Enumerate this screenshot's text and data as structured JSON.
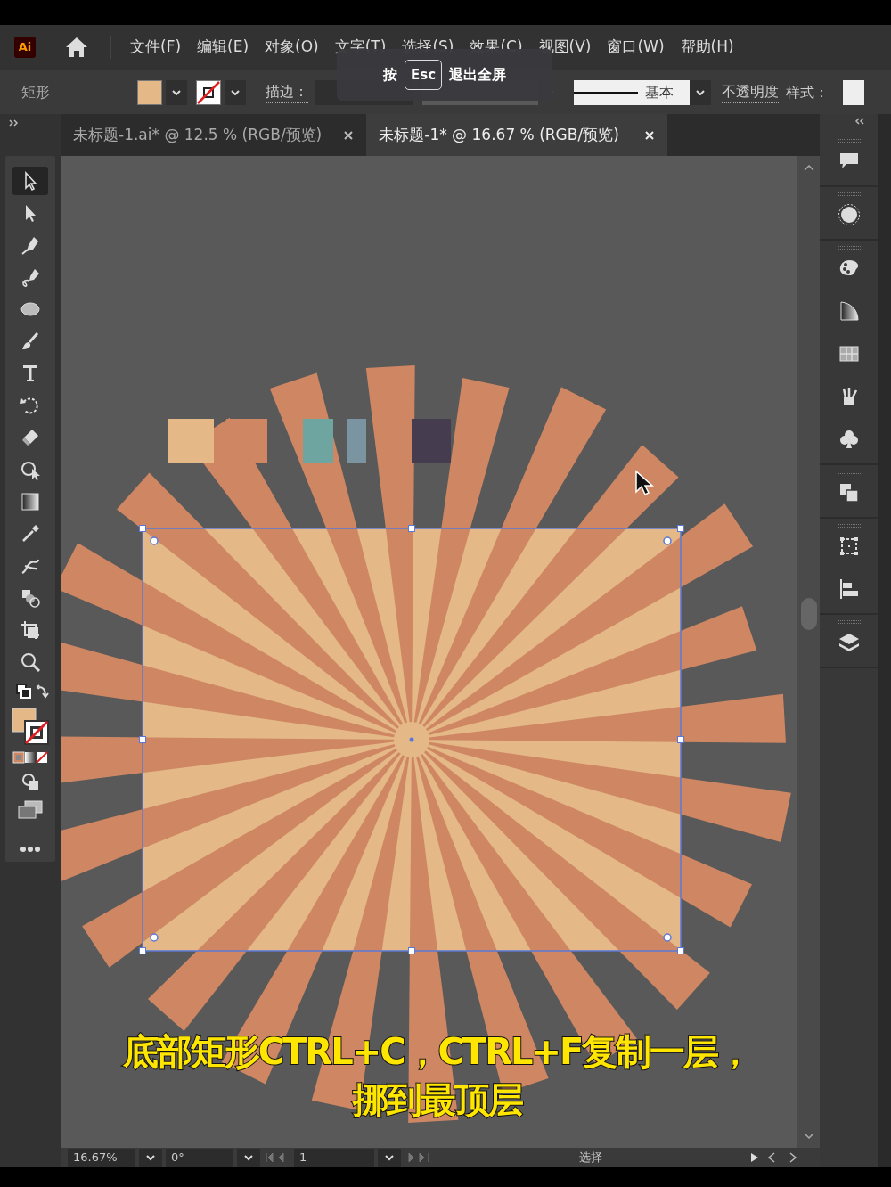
{
  "app_logo": "Ai",
  "menu": [
    "文件(F)",
    "编辑(E)",
    "对象(O)",
    "文字(T)",
    "选择(S)",
    "效果(C)",
    "视图(V)",
    "窗口(W)",
    "帮助(H)"
  ],
  "fullscreen_hint": {
    "prefix": "按",
    "key": "Esc",
    "suffix": "退出全屏"
  },
  "control_bar": {
    "tool_name": "矩形",
    "stroke_label": "描边：",
    "stroke_style": "基本",
    "opacity_label": "不透明度",
    "style_label": "样式："
  },
  "tabs": [
    {
      "label": "未标题-1.ai* @ 12.5 % (RGB/预览)",
      "selected": false
    },
    {
      "label": "未标题-1* @ 16.67 % (RGB/预览)",
      "selected": true
    }
  ],
  "tools": [
    {
      "kind": "selection",
      "selected": true
    },
    {
      "kind": "direct",
      "selected": false
    },
    {
      "kind": "pen",
      "selected": false
    },
    {
      "kind": "curvature",
      "selected": false
    },
    {
      "kind": "ellipse",
      "selected": false
    },
    {
      "kind": "brush",
      "selected": false
    },
    {
      "kind": "type",
      "selected": false
    },
    {
      "kind": "rotate",
      "selected": false
    },
    {
      "kind": "eraser",
      "selected": false
    },
    {
      "kind": "warp",
      "selected": false
    },
    {
      "kind": "gradient",
      "selected": false
    },
    {
      "kind": "eyedropper",
      "selected": false
    },
    {
      "kind": "puppet",
      "selected": false
    },
    {
      "kind": "shapebuilder",
      "selected": false
    },
    {
      "kind": "artboard",
      "selected": false
    },
    {
      "kind": "zoom",
      "selected": false
    }
  ],
  "artwork": {
    "swatches": [
      {
        "color": "#e4b887"
      },
      {
        "color": "#cf8763"
      },
      {
        "color": "#6fa5a0"
      },
      {
        "color": "#7a94a2"
      },
      {
        "color": "#453c4f"
      }
    ],
    "rectangle_selected": true
  },
  "subtitle": [
    "底部矩形CTRL+C，CTRL+F复制一层，",
    "挪到最顶层"
  ],
  "status_bar": {
    "zoom": "16.67%",
    "rotation": "0°",
    "artboard": "1",
    "tool": "选择"
  }
}
